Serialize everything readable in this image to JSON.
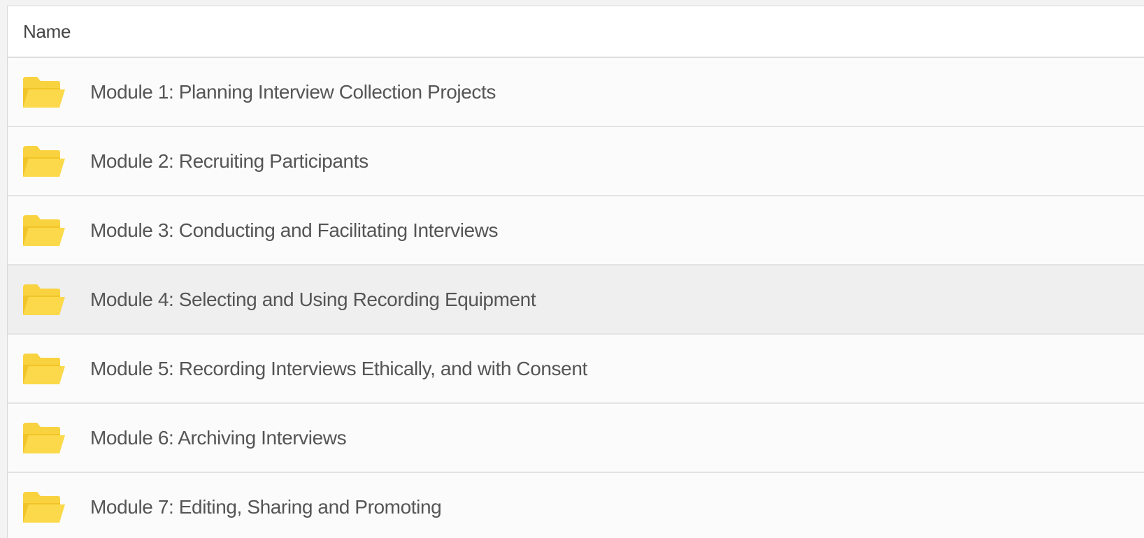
{
  "table": {
    "header": {
      "name_label": "Name"
    },
    "rows": [
      {
        "label": "Module 1: Planning Interview Collection Projects",
        "icon": "folder-open-icon"
      },
      {
        "label": "Module 2: Recruiting Participants",
        "icon": "folder-open-icon"
      },
      {
        "label": "Module 3: Conducting and Facilitating Interviews",
        "icon": "folder-open-icon"
      },
      {
        "label": "Module 4: Selecting and Using Recording Equipment",
        "icon": "folder-open-icon",
        "highlighted": true
      },
      {
        "label": "Module 5: Recording Interviews Ethically, and with Consent",
        "icon": "folder-open-icon"
      },
      {
        "label": "Module 6: Archiving Interviews",
        "icon": "folder-open-icon"
      },
      {
        "label": "Module 7: Editing, Sharing and Promoting",
        "icon": "folder-open-icon"
      }
    ]
  },
  "colors": {
    "folder": "#f9d23f",
    "folder_dark": "#efc12a",
    "row_background": "#fbfbfb",
    "row_highlight": "#efefef",
    "text": "#555555"
  }
}
